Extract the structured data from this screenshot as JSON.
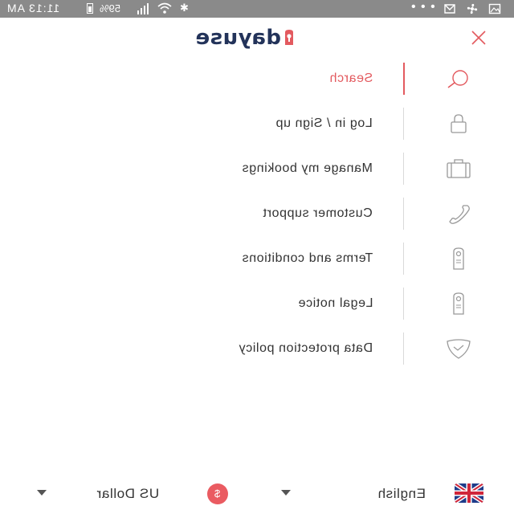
{
  "status_bar": {
    "time": "11:13 AM",
    "battery": "59%",
    "overflow": "• • •"
  },
  "header": {
    "brand": "dayuse",
    "close_icon": "close-icon",
    "brand_color": "#23335a"
  },
  "menu": {
    "accent_color": "#e35a5f",
    "items": [
      {
        "label": "Search",
        "icon": "search-icon",
        "active": true
      },
      {
        "label": "Log in / Sign up",
        "icon": "lock-icon",
        "active": false
      },
      {
        "label": "Manage my bookings",
        "icon": "suitcase-icon",
        "active": false
      },
      {
        "label": "Customer support",
        "icon": "phone-icon",
        "active": false
      },
      {
        "label": "Terms and conditions",
        "icon": "door-hanger-icon",
        "active": false
      },
      {
        "label": "Legal notice",
        "icon": "door-hanger-icon",
        "active": false
      },
      {
        "label": "Data protection policy",
        "icon": "shield-icon",
        "active": false
      }
    ]
  },
  "footer": {
    "language": {
      "value": "English",
      "icon": "uk-flag-icon"
    },
    "currency": {
      "value": "US Dollar",
      "symbol": "$",
      "badge_color": "#ea5b61"
    }
  }
}
